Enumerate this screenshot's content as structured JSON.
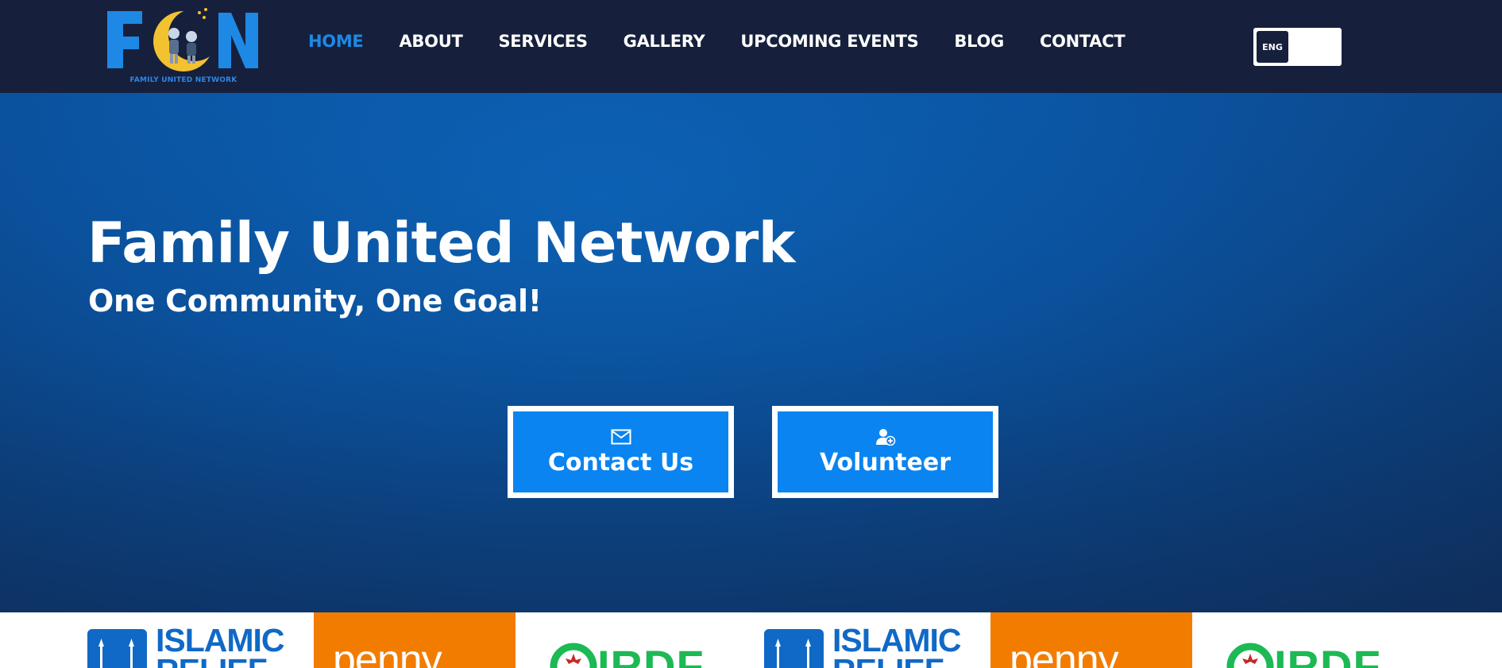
{
  "nav": {
    "logo": {
      "letters": "FUN",
      "caption": "FAMILY UNITED NETWORK"
    },
    "menu": [
      {
        "label": "HOME",
        "active": true
      },
      {
        "label": "ABOUT",
        "active": false
      },
      {
        "label": "SERVICES",
        "active": false
      },
      {
        "label": "GALLERY",
        "active": false
      },
      {
        "label": "UPCOMING EVENTS",
        "active": false
      },
      {
        "label": "BLOG",
        "active": false
      },
      {
        "label": "CONTACT",
        "active": false
      }
    ],
    "language": {
      "active": "ENG"
    }
  },
  "hero": {
    "title": "Family United Network",
    "subtitle": "One Community, One Goal!",
    "buttons": {
      "contact": {
        "label": "Contact Us",
        "icon": "envelope-icon"
      },
      "volunteer": {
        "label": "Volunteer",
        "icon": "user-plus-icon"
      }
    }
  },
  "partners": [
    {
      "name": "ISLAMIC RELIEF",
      "line1": "ISLAMIC",
      "line2": "RELIEF"
    },
    {
      "name": "penny",
      "text": "penny"
    },
    {
      "name": "IRDF",
      "text": "IRDF"
    },
    {
      "name": "ISLAMIC RELIEF",
      "line1": "ISLAMIC",
      "line2": "RELIEF"
    },
    {
      "name": "penny",
      "text": "penny"
    },
    {
      "name": "IRDF",
      "text": "IRDF"
    }
  ],
  "colors": {
    "nav_bg": "#16203c",
    "accent": "#1e88e5",
    "button_bg": "#0a84f0",
    "hero_blue": "#0b519c",
    "penny_orange": "#f27c00",
    "irdf_green": "#1db954",
    "islamic_relief_blue": "#1069c6"
  }
}
